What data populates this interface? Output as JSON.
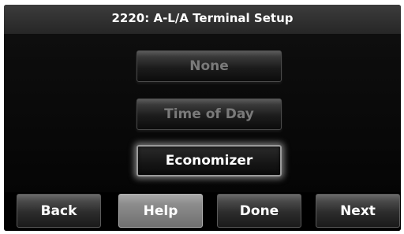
{
  "header": {
    "title": "2220: A-L/A Terminal Setup"
  },
  "options": [
    {
      "label": "None",
      "state": "unselected"
    },
    {
      "label": "Time of Day",
      "state": "unselected"
    },
    {
      "label": "Economizer",
      "state": "selected"
    }
  ],
  "nav": {
    "back_label": "Back",
    "help_label": "Help",
    "done_label": "Done",
    "next_label": "Next"
  }
}
